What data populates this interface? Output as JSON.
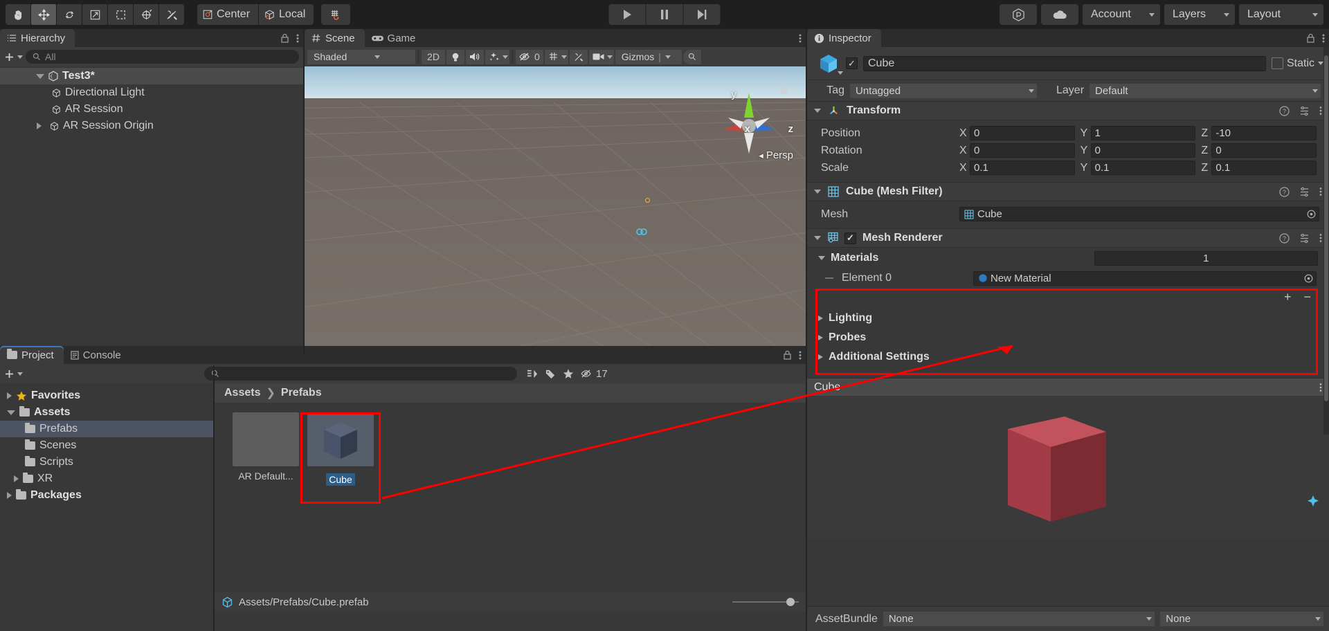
{
  "toolbar": {
    "tools": [
      {
        "name": "hand-tool",
        "icon": "hand"
      },
      {
        "name": "move-tool",
        "icon": "move",
        "active": true
      },
      {
        "name": "rotate-tool",
        "icon": "rotate"
      },
      {
        "name": "scale-tool",
        "icon": "scale"
      },
      {
        "name": "rect-tool",
        "icon": "rect"
      },
      {
        "name": "transform-tool",
        "icon": "transform"
      },
      {
        "name": "custom-tool",
        "icon": "wrench"
      }
    ],
    "pivot_label": "Center",
    "space_label": "Local",
    "snap_label": "",
    "play_label": "Play",
    "pause_label": "Pause",
    "step_label": "Step",
    "collab_label": "Collab",
    "cloud_label": "Cloud",
    "account_label": "Account",
    "layers_label": "Layers",
    "layout_label": "Layout"
  },
  "hierarchy": {
    "tab_label": "Hierarchy",
    "search_placeholder": "All",
    "create_label": "+",
    "items": [
      {
        "label": "Test3*",
        "depth": 0,
        "selected": true,
        "expanded": true,
        "icon": "unity-scene-icon"
      },
      {
        "label": "Directional Light",
        "depth": 1,
        "icon": "gameobject-icon"
      },
      {
        "label": "AR Session",
        "depth": 1,
        "icon": "gameobject-icon"
      },
      {
        "label": "AR Session Origin",
        "depth": 1,
        "expandable": true,
        "icon": "gameobject-icon"
      }
    ]
  },
  "scene": {
    "tabs": [
      {
        "label": "Scene",
        "icon": "grid-icon",
        "selected": true
      },
      {
        "label": "Game",
        "icon": "gamepad-icon",
        "selected": false
      }
    ],
    "shading_label": "Shaded",
    "mode_2d_label": "2D",
    "gizmos_label": "Gizmos",
    "audio_count": "0",
    "persp_label": "Persp",
    "axis_x": "x",
    "axis_y": "y",
    "axis_z": "z"
  },
  "inspector": {
    "tab_label": "Inspector",
    "object_name": "Cube",
    "enabled": true,
    "static_label": "Static",
    "tag_label": "Tag",
    "tag_value": "Untagged",
    "layer_label": "Layer",
    "layer_value": "Default",
    "transform": {
      "title": "Transform",
      "rows": [
        {
          "label": "Position",
          "x": "0",
          "y": "1",
          "z": "-10"
        },
        {
          "label": "Rotation",
          "x": "0",
          "y": "0",
          "z": "0"
        },
        {
          "label": "Scale",
          "x": "0.1",
          "y": "0.1",
          "z": "0.1"
        }
      ]
    },
    "mesh_filter": {
      "title": "Cube (Mesh Filter)",
      "mesh_label": "Mesh",
      "mesh_value": "Cube"
    },
    "mesh_renderer": {
      "title": "Mesh Renderer",
      "enabled": true,
      "materials_label": "Materials",
      "materials_count": "1",
      "element_label": "Element 0",
      "element_value": "New Material",
      "add_label": "+",
      "remove_label": "−"
    },
    "sections": [
      {
        "label": "Lighting"
      },
      {
        "label": "Probes"
      },
      {
        "label": "Additional Settings"
      }
    ],
    "preview_title": "Cube",
    "assetbundle_label": "AssetBundle",
    "assetbundle_value": "None",
    "assetbundle_variant": "None",
    "accent_red": "#ff0000",
    "material_color": "#a33c46"
  },
  "project": {
    "tabs": [
      {
        "label": "Project",
        "icon": "folder-icon",
        "selected": true
      },
      {
        "label": "Console",
        "icon": "console-icon",
        "selected": false
      }
    ],
    "create_label": "+",
    "search_placeholder": "",
    "hidden_count": "17",
    "tree": [
      {
        "label": "Favorites",
        "icon": "star-icon",
        "depth": 0,
        "expandable": true,
        "bold": true
      },
      {
        "label": "Assets",
        "icon": "folder-icon",
        "depth": 0,
        "expandable": true,
        "expanded": true,
        "bold": true
      },
      {
        "label": "Prefabs",
        "icon": "folder-icon",
        "depth": 1,
        "selected": true
      },
      {
        "label": "Scenes",
        "icon": "folder-icon",
        "depth": 1
      },
      {
        "label": "Scripts",
        "icon": "folder-icon",
        "depth": 1
      },
      {
        "label": "XR",
        "icon": "folder-icon",
        "depth": 1,
        "expandable": true
      },
      {
        "label": "Packages",
        "icon": "folder-icon",
        "depth": 0,
        "expandable": true,
        "bold": true
      }
    ],
    "breadcrumb": [
      "Assets",
      "Prefabs"
    ],
    "assets": [
      {
        "label": "AR Default...",
        "selected": false,
        "type": "blank"
      },
      {
        "label": "Cube",
        "selected": true,
        "type": "cube"
      }
    ],
    "status_path": "Assets/Prefabs/Cube.prefab",
    "zoom_value": "95"
  }
}
